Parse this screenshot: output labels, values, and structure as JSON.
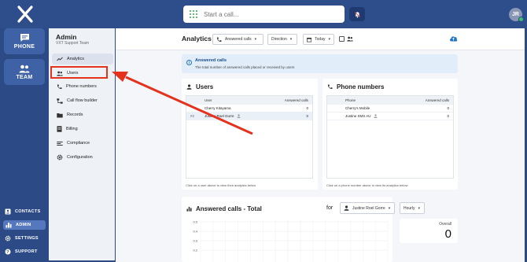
{
  "topbar": {
    "call_placeholder": "Start a call...",
    "avatar_initials": "JR"
  },
  "rail": {
    "phone_label": "PHONE",
    "team_label": "TEAM",
    "links": [
      {
        "label": "CONTACTS",
        "icon": "contacts-icon"
      },
      {
        "label": "ADMIN",
        "icon": "bar-chart-icon",
        "active": true
      },
      {
        "label": "SETTINGS",
        "icon": "gear-icon"
      },
      {
        "label": "SUPPORT",
        "icon": "help-icon"
      }
    ]
  },
  "admin": {
    "title": "Admin",
    "team": "VXT Support Team",
    "nav": [
      {
        "label": "Analytics",
        "icon": "trend-icon",
        "active": true
      },
      {
        "label": "Users",
        "icon": "users-icon",
        "highlighted": true
      },
      {
        "label": "Phone numbers",
        "icon": "phone-icon"
      },
      {
        "label": "Call flow builder",
        "icon": "flow-icon"
      },
      {
        "label": "Records",
        "icon": "folder-icon"
      },
      {
        "label": "Billing",
        "icon": "billing-icon"
      },
      {
        "label": "Compliance",
        "icon": "compliance-icon"
      },
      {
        "label": "Configuration",
        "icon": "gear-icon"
      }
    ]
  },
  "analytics": {
    "title": "Analytics",
    "filter_metric": "Answered calls",
    "filter_direction": "Direction",
    "filter_range": "Today",
    "info_title": "Answered calls",
    "info_text": "The total number of answered calls placed or received by users"
  },
  "users_card": {
    "title": "Users",
    "col_user": "User",
    "col_answered": "Answered calls",
    "rows": [
      {
        "rank": "",
        "name": "Cherry Kitayama",
        "value": "0"
      },
      {
        "rank": "#2",
        "name": "Justine Roel Gorre",
        "value": "0"
      }
    ],
    "footer": "Click on a user above to view their analytics below"
  },
  "phones_card": {
    "title": "Phone numbers",
    "col_phone": "Phone",
    "col_answered": "Answered calls",
    "rows": [
      {
        "name": "Cherry's Mobile",
        "value": "0"
      },
      {
        "name": "Justine SMS AU",
        "value": "0"
      }
    ],
    "footer": "Click on a phone number above to view its analytics below"
  },
  "chart": {
    "title": "Answered calls - Total",
    "for_label": "for",
    "user_select": "Justine Roel Gorre",
    "interval_select": "Hourly",
    "overall_label": "Overall",
    "overall_value": "0"
  },
  "chart_data": {
    "type": "line",
    "title": "Answered calls - Total",
    "y_ticks": [
      "0.5",
      "0.4",
      "0.3",
      "0.2"
    ],
    "ylim": [
      0,
      0.5
    ],
    "series": [],
    "grid": true
  }
}
